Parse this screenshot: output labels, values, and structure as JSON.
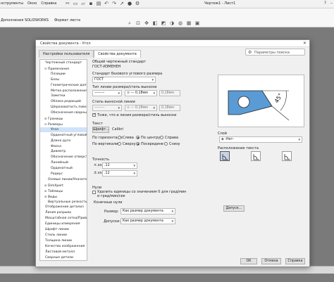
{
  "app": {
    "menu": [
      "нструменты",
      "Окно",
      "Справка"
    ],
    "window_title": "Чертеж1 - Лист1",
    "cmd_tabs": [
      "Дополнения SOLIDWORKS",
      "Формат листа"
    ]
  },
  "dialog": {
    "title": "Свойства документа - Угол",
    "tabs": [
      "Настройки пользователя",
      "Свойства документа"
    ],
    "search_placeholder": "Параметры поиска",
    "tree": [
      {
        "label": "Чертежный стандарт",
        "level": 0,
        "exp": ""
      },
      {
        "label": "Примечания",
        "level": 1,
        "exp": "−"
      },
      {
        "label": "Позиции",
        "level": 2,
        "exp": ""
      },
      {
        "label": "Базы",
        "level": 2,
        "exp": ""
      },
      {
        "label": "Геометрические допу",
        "level": 2,
        "exp": ""
      },
      {
        "label": "Метка расположения",
        "level": 2,
        "exp": ""
      },
      {
        "label": "Заметки",
        "level": 2,
        "exp": ""
      },
      {
        "label": "Облака редакций",
        "level": 2,
        "exp": ""
      },
      {
        "label": "Шероховатость повер",
        "level": 2,
        "exp": ""
      },
      {
        "label": "Обозначения сварных",
        "level": 2,
        "exp": ""
      },
      {
        "label": "Границы",
        "level": 1,
        "exp": "+"
      },
      {
        "label": "Размеры",
        "level": 1,
        "exp": "−"
      },
      {
        "label": "Угол",
        "level": 2,
        "exp": "",
        "selected": true
      },
      {
        "label": "Ординатный угловой",
        "level": 2,
        "exp": ""
      },
      {
        "label": "Длина дуги",
        "level": 2,
        "exp": ""
      },
      {
        "label": "Фаска",
        "level": 2,
        "exp": ""
      },
      {
        "label": "Диаметр",
        "level": 2,
        "exp": ""
      },
      {
        "label": "Обозначение отверст",
        "level": 2,
        "exp": ""
      },
      {
        "label": "Линейный",
        "level": 2,
        "exp": ""
      },
      {
        "label": "Ординатный",
        "level": 2,
        "exp": ""
      },
      {
        "label": "Радиус",
        "level": 2,
        "exp": ""
      },
      {
        "label": "Осевые линии/Указатель",
        "level": 1,
        "exp": ""
      },
      {
        "label": "DimXpert",
        "level": 1,
        "exp": "+"
      },
      {
        "label": "Таблицы",
        "level": 1,
        "exp": "+"
      },
      {
        "label": "Виды",
        "level": 1,
        "exp": "+"
      },
      {
        "label": "Виртуальные резкость",
        "level": 1,
        "exp": ""
      },
      {
        "label": "Отображение детализ",
        "level": 0,
        "exp": ""
      },
      {
        "label": "Линия разрыва",
        "level": 0,
        "exp": ""
      },
      {
        "label": "Масштабная сетка/Привязать",
        "level": 0,
        "exp": ""
      },
      {
        "label": "Единицы измерения",
        "level": 0,
        "exp": ""
      },
      {
        "label": "Шрифт линии",
        "level": 0,
        "exp": ""
      },
      {
        "label": "Стиль линии",
        "level": 0,
        "exp": ""
      },
      {
        "label": "Толщина линии",
        "level": 0,
        "exp": ""
      },
      {
        "label": "Качество изображения",
        "level": 0,
        "exp": ""
      },
      {
        "label": "Листовой металл",
        "level": 0,
        "exp": ""
      },
      {
        "label": "Сварные детали",
        "level": 0,
        "exp": ""
      }
    ],
    "overall_standard_label": "Общий чертежный стандарт",
    "overall_standard_value": "ГОСТ-ИЗМЕНЕН",
    "base_standard_label": "Стандарт базового углового размера",
    "base_standard_value": "ГОСТ",
    "leader_style_label": "Тип линии размера/стиль выноски",
    "leader_thickness": "0,18мм",
    "leader_thickness2": "0,18мм",
    "ext_style_label": "Стиль выносной линии",
    "ext_thickness": "0,18мм",
    "ext_thickness2": "0,18мм",
    "same_style_label": "Тоже, что и линия размера/стиль выноски",
    "text_label": "Текст",
    "font_button": "Шрифт...",
    "font_name": "Calibri",
    "horizontal_label": "По горизонтали:",
    "vertical_label": "По вертикали:",
    "h_options": [
      "Слева",
      "По центру",
      "Справа"
    ],
    "v_options": [
      "Сверху",
      "Посередине",
      "Снизу"
    ],
    "precision_label": "Точность",
    "precision1": ".12",
    "precision2": ".12",
    "zeros_label": "Нули",
    "remove_zero_label": "Удалить единицы со значением 0 для град/мин и град/мин/сек",
    "end_zeros_label": "Конечные нули",
    "dimensions_label": "Размер:",
    "dimensions_value": "Как размер документа",
    "tolerance_label": "Допуски:",
    "tolerance_value": "Как размер документа",
    "layer_label": "Слой",
    "layer_value": "-Нет-",
    "text_position_label": "Расположение текста",
    "tolerance_button": "Допуск...",
    "preview_angle": "45°",
    "ok": "OK",
    "cancel": "Отмена",
    "help": "Справка"
  },
  "colors": {
    "accent": "#5b9bd5",
    "selection": "#cfe3f8"
  }
}
